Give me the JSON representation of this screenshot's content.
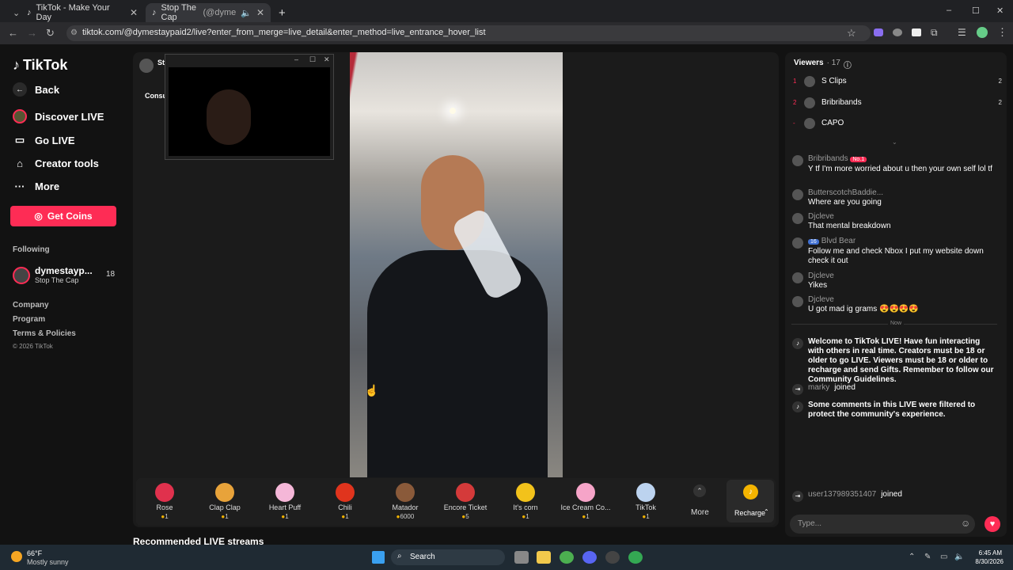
{
  "browser": {
    "tabs": [
      {
        "label": "TikTok - Make Your Day",
        "icon": "tiktok-icon"
      },
      {
        "label": "Stop The Cap",
        "extra": "(@dyme",
        "icon": "tiktok-icon"
      }
    ],
    "new_tab": "+",
    "url": "tiktok.com/@dymestaypaid2/live?enter_from_merge=live_detail&enter_method=live_entrance_hover_list",
    "window_controls": [
      "–",
      "☐",
      "✕"
    ]
  },
  "sidebar": {
    "logo": "TikTok",
    "items": [
      {
        "label": "Back",
        "icon": "back-arrow-icon"
      },
      {
        "label": "Discover LIVE",
        "icon": "live-icon"
      },
      {
        "label": "Go LIVE",
        "icon": "camera-icon"
      },
      {
        "label": "Creator tools",
        "icon": "home-icon"
      },
      {
        "label": "More",
        "icon": "ellipsis-icon"
      }
    ],
    "get_coins": "Get Coins",
    "following_heading": "Following",
    "following": [
      {
        "name": "dymestayp...",
        "sub": "Stop The Cap",
        "count": "18"
      }
    ],
    "footer": [
      "Company",
      "Program",
      "Terms & Policies"
    ],
    "copyright": "© 2026 TikTok"
  },
  "stream": {
    "host_abbrev": "St",
    "host_sub": "Consu"
  },
  "gifts": [
    {
      "name": "Rose",
      "price": "1",
      "color": "#e0314d"
    },
    {
      "name": "Clap Clap",
      "price": "1",
      "color": "#e8a33a"
    },
    {
      "name": "Heart Puff",
      "price": "1",
      "color": "#f5b7d8"
    },
    {
      "name": "Chili",
      "price": "1",
      "color": "#e0341d"
    },
    {
      "name": "Matador",
      "price": "6000",
      "color": "#8a5a3a"
    },
    {
      "name": "Encore Ticket",
      "price": "5",
      "color": "#d43a3a"
    },
    {
      "name": "It's corn",
      "price": "1",
      "color": "#f2c21b"
    },
    {
      "name": "Ice Cream Co...",
      "price": "1",
      "color": "#f6a4c8"
    },
    {
      "name": "TikTok",
      "price": "1",
      "color": "#bcd3ef"
    }
  ],
  "more_label": "More",
  "recharge_label": "Recharge",
  "recommended_heading": "Recommended LIVE streams",
  "viewers": {
    "title": "Viewers",
    "count": "· 17",
    "list": [
      {
        "rank": "1",
        "name": "S Clips",
        "score": "2"
      },
      {
        "rank": "2",
        "name": "Bribribands",
        "score": "2"
      },
      {
        "rank": "-",
        "name": "CAPO",
        "score": ""
      }
    ]
  },
  "comments": [
    {
      "user": "Bribribands",
      "badge": "No.1",
      "text": "Y tf I'm more worried about u then your own self lol tf"
    },
    {
      "user": "ButterscotchBaddie...",
      "badge": "",
      "text": "Where are you going"
    },
    {
      "user": "Djcleve",
      "badge": "",
      "text": "That mental breakdown"
    },
    {
      "user": "Blvd Bear",
      "badge": "16",
      "text": "Follow me and check Nbox I put my website down check it out"
    },
    {
      "user": "Djcleve",
      "badge": "",
      "text": "Yikes"
    },
    {
      "user": "Djcleve",
      "badge": "",
      "text": "U got mad ig grams 😍😍😍😍"
    }
  ],
  "now_label": "Now",
  "system_messages": [
    {
      "text": "Welcome to TikTok LIVE! Have fun interacting with others in real time. Creators must be 18 or older to go LIVE. Viewers must be 18 or older to recharge and send Gifts. Remember to follow our Community Guidelines."
    },
    {
      "user": "marky",
      "text": "joined"
    },
    {
      "text": "Some comments in this LIVE were filtered to protect the community's experience."
    },
    {
      "user": "user137989351407",
      "text": "joined"
    }
  ],
  "chat_input_placeholder": "Type...",
  "taskbar": {
    "weather_temp": "66°F",
    "weather_desc": "Mostly sunny",
    "search": "Search",
    "time": "6:45 AM",
    "date": "8/30/2026"
  }
}
